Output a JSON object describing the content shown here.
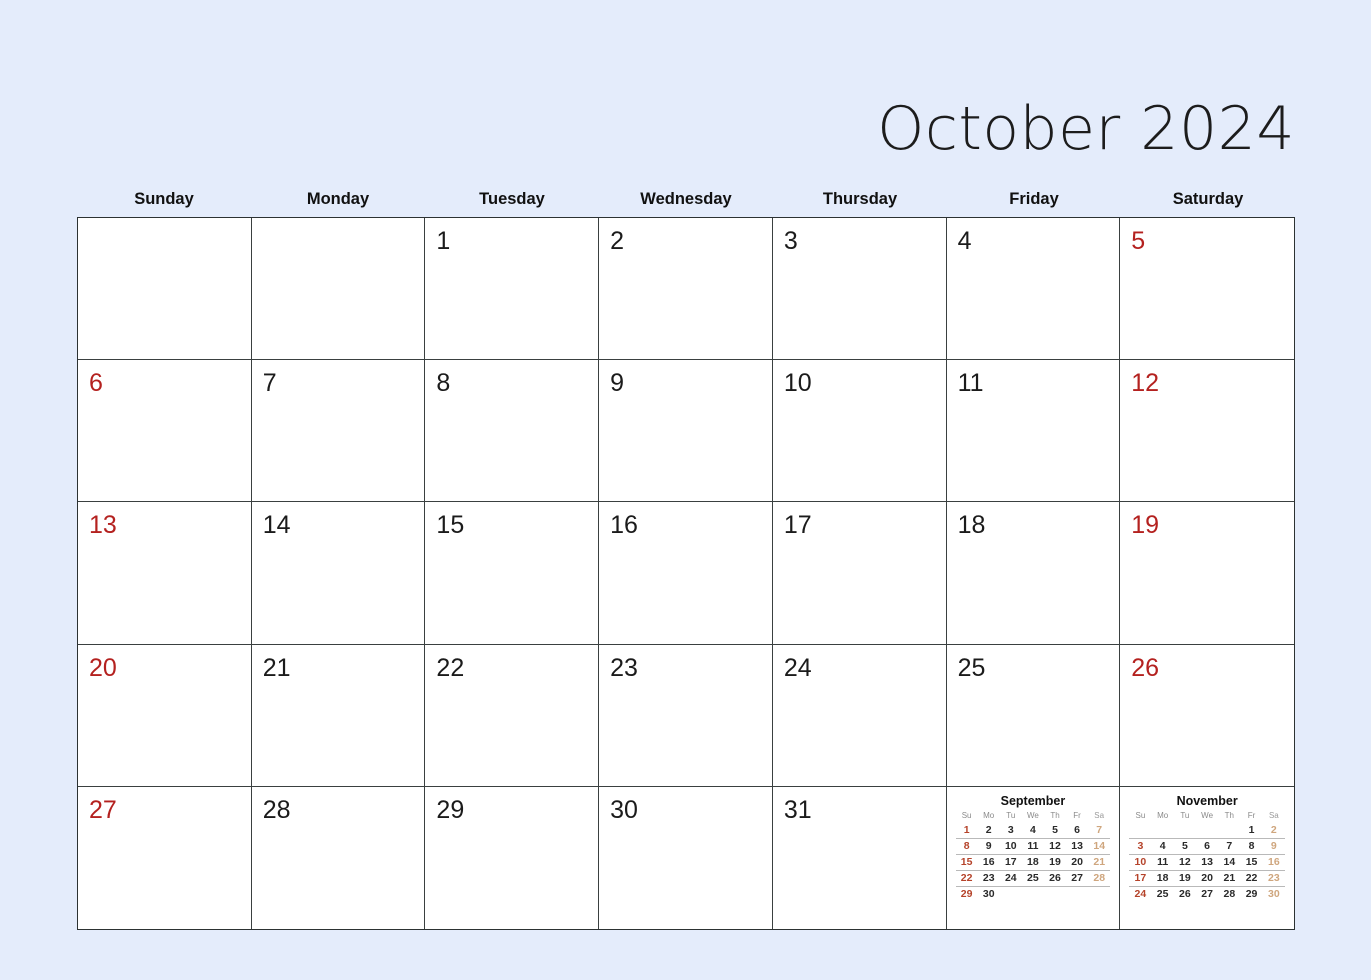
{
  "title": "October 2024",
  "colors": {
    "background": "#e4ecfb",
    "page": "#ffffff",
    "border": "#2c3232",
    "weekend": "#b4211f",
    "mini_sunday": "#b5432a",
    "mini_saturday": "#cfa67e",
    "text": "#1b1b1b"
  },
  "weekdays": [
    {
      "label": "Sunday"
    },
    {
      "label": "Monday"
    },
    {
      "label": "Tuesday"
    },
    {
      "label": "Wednesday"
    },
    {
      "label": "Thursday"
    },
    {
      "label": "Friday"
    },
    {
      "label": "Saturday"
    }
  ],
  "grid": {
    "rows": [
      [
        {
          "day": "",
          "weekend": true
        },
        {
          "day": "",
          "weekend": false
        },
        {
          "day": "1",
          "weekend": false
        },
        {
          "day": "2",
          "weekend": false
        },
        {
          "day": "3",
          "weekend": false
        },
        {
          "day": "4",
          "weekend": false
        },
        {
          "day": "5",
          "weekend": true
        }
      ],
      [
        {
          "day": "6",
          "weekend": true
        },
        {
          "day": "7",
          "weekend": false
        },
        {
          "day": "8",
          "weekend": false
        },
        {
          "day": "9",
          "weekend": false
        },
        {
          "day": "10",
          "weekend": false
        },
        {
          "day": "11",
          "weekend": false
        },
        {
          "day": "12",
          "weekend": true
        }
      ],
      [
        {
          "day": "13",
          "weekend": true
        },
        {
          "day": "14",
          "weekend": false
        },
        {
          "day": "15",
          "weekend": false
        },
        {
          "day": "16",
          "weekend": false
        },
        {
          "day": "17",
          "weekend": false
        },
        {
          "day": "18",
          "weekend": false
        },
        {
          "day": "19",
          "weekend": true
        }
      ],
      [
        {
          "day": "20",
          "weekend": true
        },
        {
          "day": "21",
          "weekend": false
        },
        {
          "day": "22",
          "weekend": false
        },
        {
          "day": "23",
          "weekend": false
        },
        {
          "day": "24",
          "weekend": false
        },
        {
          "day": "25",
          "weekend": false
        },
        {
          "day": "26",
          "weekend": true
        }
      ],
      [
        {
          "day": "27",
          "weekend": true
        },
        {
          "day": "28",
          "weekend": false
        },
        {
          "day": "29",
          "weekend": false
        },
        {
          "day": "30",
          "weekend": false
        },
        {
          "day": "31",
          "weekend": false
        },
        {
          "day": "",
          "weekend": false,
          "mini": "september"
        },
        {
          "day": "",
          "weekend": true,
          "mini": "november"
        }
      ]
    ]
  },
  "mini_calendars": {
    "september": {
      "title": "September",
      "headers": [
        "Su",
        "Mo",
        "Tu",
        "We",
        "Th",
        "Fr",
        "Sa"
      ],
      "weeks": [
        [
          "1",
          "2",
          "3",
          "4",
          "5",
          "6",
          "7"
        ],
        [
          "8",
          "9",
          "10",
          "11",
          "12",
          "13",
          "14"
        ],
        [
          "15",
          "16",
          "17",
          "18",
          "19",
          "20",
          "21"
        ],
        [
          "22",
          "23",
          "24",
          "25",
          "26",
          "27",
          "28"
        ],
        [
          "29",
          "30",
          "",
          "",
          "",
          "",
          ""
        ]
      ]
    },
    "november": {
      "title": "November",
      "headers": [
        "Su",
        "Mo",
        "Tu",
        "We",
        "Th",
        "Fr",
        "Sa"
      ],
      "weeks": [
        [
          "",
          "",
          "",
          "",
          "",
          "1",
          "2"
        ],
        [
          "3",
          "4",
          "5",
          "6",
          "7",
          "8",
          "9"
        ],
        [
          "10",
          "11",
          "12",
          "13",
          "14",
          "15",
          "16"
        ],
        [
          "17",
          "18",
          "19",
          "20",
          "21",
          "22",
          "23"
        ],
        [
          "24",
          "25",
          "26",
          "27",
          "28",
          "29",
          "30"
        ]
      ]
    }
  }
}
